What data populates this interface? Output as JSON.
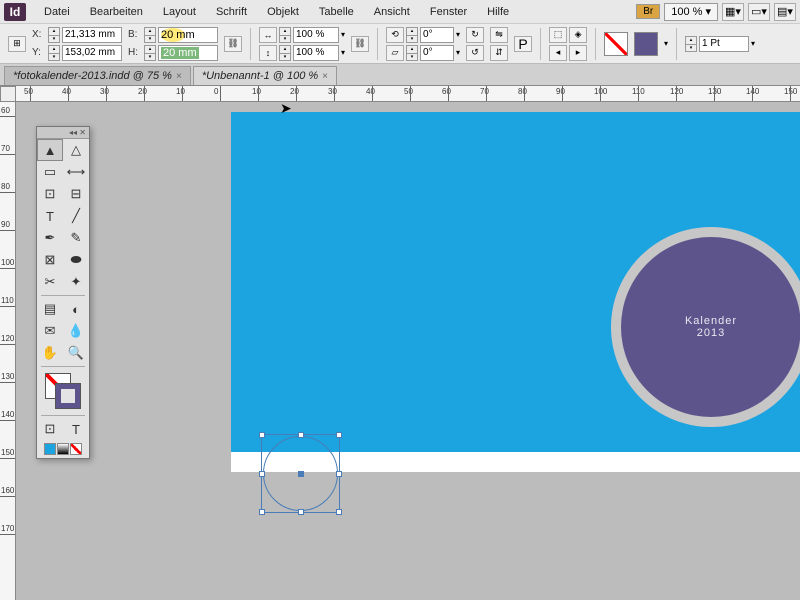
{
  "app": {
    "icon_label": "Id"
  },
  "menu": {
    "items": [
      "Datei",
      "Bearbeiten",
      "Layout",
      "Schrift",
      "Objekt",
      "Tabelle",
      "Ansicht",
      "Fenster",
      "Hilfe"
    ],
    "badge": "Br",
    "zoom": "100 %  ▾"
  },
  "control": {
    "x_label": "X:",
    "x": "21,313 mm",
    "y_label": "Y:",
    "y": "153,02 mm",
    "b_label": "B:",
    "b": "20 mm",
    "h_label": "H:",
    "h": "20 mm",
    "scale_x": "100 %",
    "scale_y": "100 %",
    "rot": "0°",
    "shear": "0°",
    "stroke": "1 Pt"
  },
  "tabs": [
    {
      "label": "*fotokalender-2013.indd @ 75 %",
      "active": false
    },
    {
      "label": "*Unbenannt-1 @ 100 %",
      "active": true
    }
  ],
  "ruler_h": [
    "50",
    "40",
    "30",
    "20",
    "10",
    "0",
    "10",
    "20",
    "30",
    "40",
    "50",
    "60",
    "70",
    "80",
    "90",
    "100",
    "110",
    "120",
    "130",
    "140",
    "150"
  ],
  "ruler_v": [
    "60",
    "70",
    "80",
    "90",
    "100",
    "110",
    "120",
    "130",
    "140",
    "150",
    "160",
    "170"
  ],
  "artwork": {
    "title_line1": "Kalender",
    "title_line2": "2013"
  },
  "tools": {
    "row": [
      [
        "selection",
        "direct-selection"
      ],
      [
        "page",
        "gap"
      ],
      [
        "content-collector",
        "content-placer"
      ],
      [
        "type",
        "line"
      ],
      [
        "pen",
        "pencil"
      ],
      [
        "rectangle-frame",
        "rectangle"
      ],
      [
        "scissors",
        "free-transform"
      ],
      [
        "gradient-swatch",
        "gradient-feather"
      ],
      [
        "note",
        "eyedropper"
      ],
      [
        "hand",
        "zoom"
      ]
    ],
    "bottom": [
      "view-normal",
      "view-preview"
    ]
  }
}
